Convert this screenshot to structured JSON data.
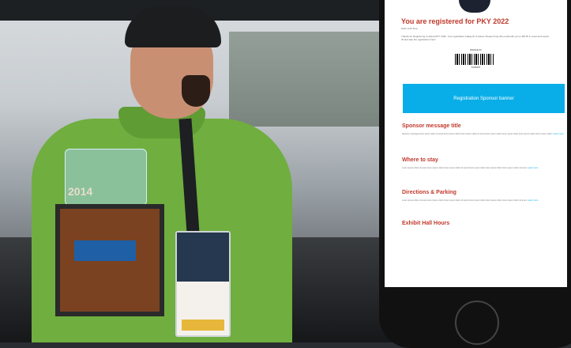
{
  "photo": {
    "trophy_text": "2014"
  },
  "email": {
    "title": "You are registered for PKY 2022",
    "greeting": "Hello John Doe,",
    "intro": "Thanks for Registering to attend PKY 2022. Your registration badge ID is below. Please bring this email with you to MKTP to reset and reprint ID and skip the registration lines!",
    "badge_label": "BADGE ID",
    "badge_number": "1234567",
    "banner_text": "Registration Sponsor banner",
    "sections": [
      {
        "title": "Sponsor message title",
        "body": "Sponsor message lorem ipsum dolor sit amet lorem ipsum dolor lorem ipsum dolor sit amet lorem ipsum dolor lorem ipsum dolor lorem ipsum dolor lorem ipsum dolor.",
        "link": "Learn more"
      },
      {
        "title": "Where to stay",
        "body": "Lorem ipsum dolor sit amet lorem ipsum dolor lorem ipsum dolor sit amet lorem ipsum dolor lorem ipsum dolor lorem ipsum dolor sit amet.",
        "link": "Learn more"
      },
      {
        "title": "Directions & Parking",
        "body": "Lorem ipsum dolor sit amet lorem ipsum dolor lorem ipsum dolor sit amet lorem ipsum dolor lorem ipsum dolor lorem ipsum dolor sit amet.",
        "link": "Learn more"
      },
      {
        "title": "Exhibit Hall Hours",
        "body": "",
        "link": ""
      }
    ]
  }
}
